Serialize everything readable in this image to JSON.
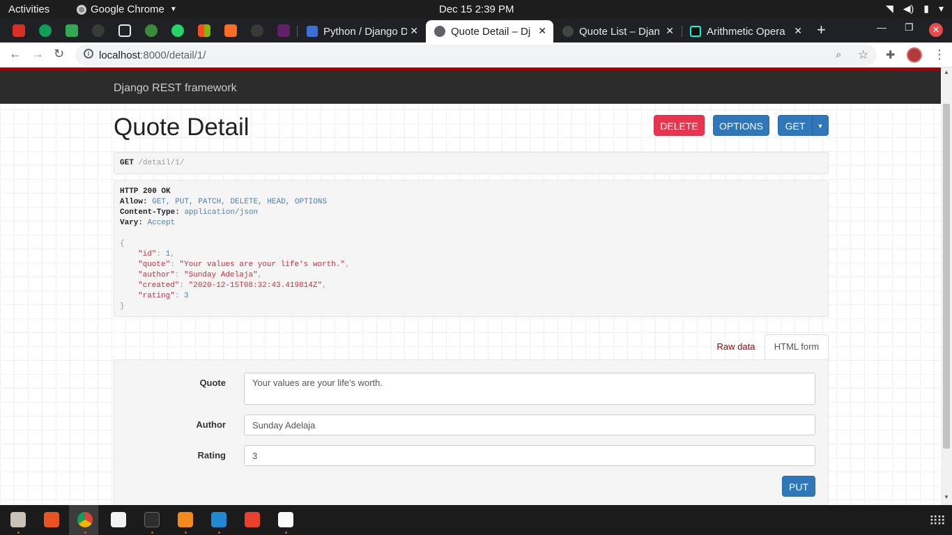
{
  "system_bar": {
    "activities": "Activities",
    "app_name": "Google Chrome",
    "clock": "Dec 15  2:39 PM"
  },
  "tabs": [
    {
      "title": "Python / Django D",
      "favicon_color": "#3c6fd8",
      "active": false
    },
    {
      "title": "Quote Detail – Dj",
      "favicon_color": "#5f6368",
      "active": true
    },
    {
      "title": "Quote List – Djan",
      "favicon_color": "#444",
      "active": false
    },
    {
      "title": "Arithmetic Opera",
      "favicon_color": "#1a1a1a",
      "active": false
    }
  ],
  "pinned_tab_icons": [
    "gmail-icon",
    "hangouts-icon",
    "google-meet-icon",
    "github-icon",
    "peace-icon",
    "settings-gear-icon",
    "whatsapp-icon",
    "microsoft-icon",
    "gitlab-icon",
    "github-icon",
    "slack-icon"
  ],
  "address_bar": {
    "host": "localhost",
    "path": ":8000/detail/1/"
  },
  "drf": {
    "brand": "Django REST framework",
    "page_title": "Quote Detail",
    "buttons": {
      "delete": "DELETE",
      "options": "OPTIONS",
      "get": "GET",
      "put": "PUT"
    },
    "request": {
      "method": "GET",
      "path": "/detail/1/"
    },
    "response": {
      "status": "HTTP 200 OK",
      "headers": [
        {
          "key": "Allow",
          "value": "GET, PUT, PATCH, DELETE, HEAD, OPTIONS"
        },
        {
          "key": "Content-Type",
          "value": "application/json"
        },
        {
          "key": "Vary",
          "value": "Accept"
        }
      ],
      "json": {
        "id": "1",
        "quote": "\"Your values are your life's worth.\"",
        "author": "\"Sunday Adelaja\"",
        "created": "\"2020-12-15T08:32:43.419814Z\"",
        "rating": "3"
      }
    },
    "form_tabs": {
      "raw": "Raw data",
      "html": "HTML form"
    },
    "form": {
      "quote_label": "Quote",
      "quote_value": "Your values are your life's worth.",
      "author_label": "Author",
      "author_value": "Sunday Adelaja",
      "rating_label": "Rating",
      "rating_value": "3"
    }
  },
  "dock_items": [
    "files-icon",
    "app-store-icon",
    "chrome-icon",
    "text-editor-icon",
    "terminal-icon",
    "sublime-text-icon",
    "vscode-icon",
    "git-client-icon",
    "document-viewer-icon"
  ],
  "colors": {
    "drf_red": "#a30000",
    "btn_primary": "#2f77b8",
    "btn_danger": "#e8344f"
  }
}
